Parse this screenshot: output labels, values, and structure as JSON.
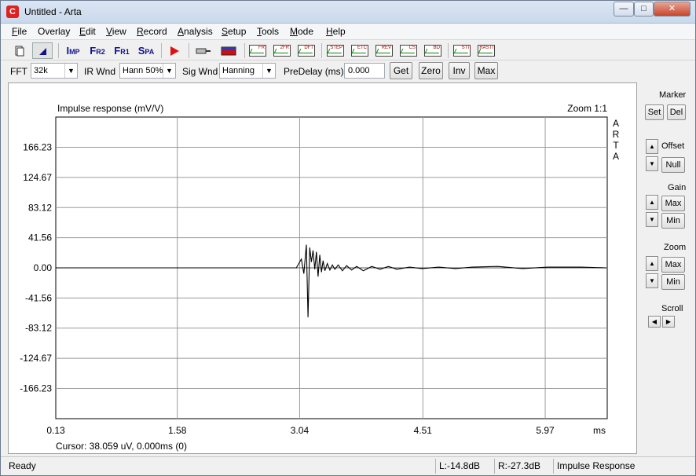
{
  "window": {
    "title": "Untitled - Arta",
    "icon": "arta-app-icon",
    "min": "—",
    "max": "□",
    "close": "✕"
  },
  "menu": [
    {
      "u": "F",
      "rest": "ile"
    },
    {
      "u": "",
      "rest": "Overlay"
    },
    {
      "u": "E",
      "rest": "dit"
    },
    {
      "u": "V",
      "rest": "iew"
    },
    {
      "u": "R",
      "rest": "ecord"
    },
    {
      "u": "A",
      "rest": "nalysis"
    },
    {
      "u": "S",
      "rest": "etup"
    },
    {
      "u": "T",
      "rest": "ools"
    },
    {
      "u": "M",
      "rest": "ode"
    },
    {
      "u": "H",
      "rest": "elp"
    }
  ],
  "toolbar": {
    "imp": {
      "big": "I",
      "small": "MP"
    },
    "fr2": {
      "big": "F",
      "small": "R2"
    },
    "fr1": {
      "big": "F",
      "small": "R1"
    },
    "spa": {
      "big": "S",
      "small": "PA"
    },
    "graph_labels": [
      "FR",
      "2FR",
      "DFT",
      "STEP",
      "ETC",
      "REV",
      "CS",
      "BD",
      "STI",
      "RASTI"
    ]
  },
  "params": {
    "fft_label": "FFT",
    "fft_value": "32k",
    "irwnd_label": "IR Wnd",
    "irwnd_value": "Hann 50%",
    "sigwnd_label": "Sig Wnd",
    "sigwnd_value": "Hanning",
    "predelay_label": "PreDelay (ms)",
    "predelay_value": "0.000",
    "get": "Get",
    "zero": "Zero",
    "inv": "Inv",
    "max": "Max"
  },
  "plot": {
    "title": "Impulse response (mV/V)",
    "zoom": "Zoom 1:1",
    "watermark": [
      "A",
      "R",
      "T",
      "A"
    ],
    "cursor": "Cursor: 38.059 uV, 0.000ms (0)"
  },
  "side": {
    "marker": "Marker",
    "set": "Set",
    "del": "Del",
    "offset": "Offset",
    "null": "Null",
    "gain": "Gain",
    "gain_max": "Max",
    "gain_min": "Min",
    "zoom": "Zoom",
    "zoom_max": "Max",
    "zoom_min": "Min",
    "scroll": "Scroll",
    "up": "▲",
    "down": "▼",
    "left": "◀",
    "right": "▶"
  },
  "status": {
    "ready": "Ready",
    "left": "L:-14.8dB",
    "right": "R:-27.3dB",
    "mode": "Impulse Response"
  },
  "chart_data": {
    "type": "line",
    "title": "Impulse response (mV/V)",
    "xlabel": "ms",
    "ylabel": "",
    "xlim": [
      0.13,
      5.97
    ],
    "ylim": [
      -166.23,
      166.23
    ],
    "x_ticks": [
      "0.13",
      "1.58",
      "3.04",
      "4.51",
      "5.97"
    ],
    "y_ticks": [
      "166.23",
      "124.67",
      "83.12",
      "41.56",
      "0.00",
      "-41.56",
      "-83.12",
      "-124.67",
      "-166.23"
    ],
    "grid": true,
    "series": [
      {
        "x": [
          0.13,
          3.0,
          3.06,
          3.09,
          3.12,
          3.14,
          3.16,
          3.18,
          3.2,
          3.22,
          3.24,
          3.26,
          3.28,
          3.3,
          3.32,
          3.34,
          3.37,
          3.4,
          3.43,
          3.46,
          3.5,
          3.55,
          3.6,
          3.66,
          3.72,
          3.8,
          3.9,
          4.0,
          4.1,
          4.2,
          4.35,
          4.5,
          4.7,
          4.9,
          5.1,
          5.4,
          5.7,
          6.0,
          6.4,
          6.7
        ],
        "y": [
          0,
          0,
          12,
          -8,
          32,
          -68,
          28,
          8,
          24,
          -2,
          22,
          -12,
          18,
          -6,
          10,
          -4,
          6,
          -3,
          4,
          -2,
          4,
          -4,
          3,
          -3,
          2,
          -4,
          2,
          -2,
          2,
          -2,
          1,
          -1,
          1,
          -1,
          1,
          2,
          -1,
          1,
          1,
          0
        ]
      }
    ]
  }
}
